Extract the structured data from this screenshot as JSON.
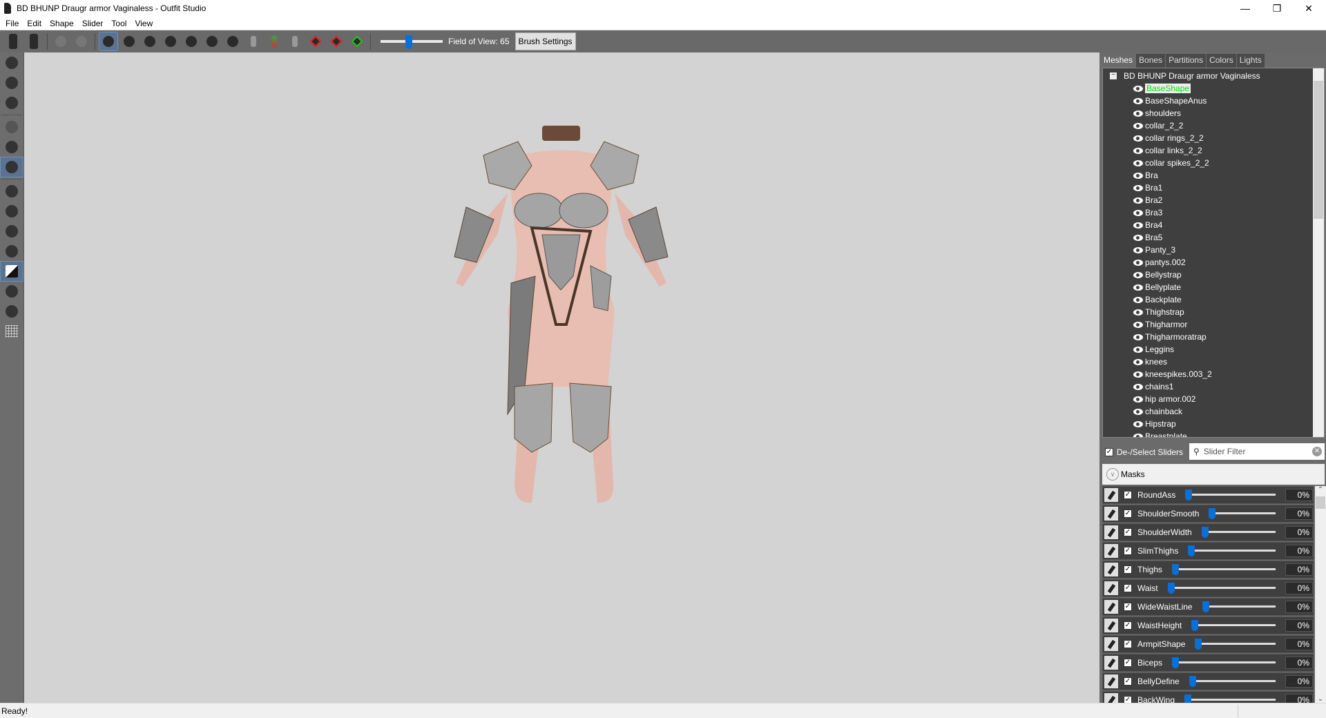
{
  "window": {
    "title": "BD BHUNP Draugr armor Vaginaless - Outfit Studio",
    "controls": [
      "minimize",
      "restore",
      "close"
    ]
  },
  "menu": [
    "File",
    "Edit",
    "Shape",
    "Slider",
    "Tool",
    "View"
  ],
  "toolbar": {
    "tools": [
      "load-reference-icon",
      "load-outfit-icon",
      "undo-icon",
      "redo-icon",
      "select-brush-icon",
      "mask-brush-icon",
      "inflate-brush-icon",
      "deflate-brush-icon",
      "move-brush-icon",
      "smooth-brush-icon",
      "undiff-brush-icon",
      "weight-brush-icon",
      "color-brush-icon",
      "alpha-brush-icon",
      "collapse-vertex-icon",
      "flip-edge-icon",
      "split-edge-icon"
    ],
    "active_tool": "select-brush-icon",
    "fov_label": "Field of View: 65",
    "fov_value": 65,
    "brush_settings_label": "Brush Settings",
    "right_icons": [
      "discord-icon",
      "github-icon",
      "paypal-icon"
    ]
  },
  "left_tools": [
    "transform-icon",
    "pivot-icon",
    "vertex-select-icon",
    "mirror-icon",
    "connected-only-icon",
    "global-brush-icon",
    "brush-center-icon",
    "brush-full-icon",
    "brush-left-icon",
    "brush-right-icon",
    "shaded-mode-icon",
    "wireframe-icon",
    "bones-icon",
    "grid-icon"
  ],
  "right_panel": {
    "tabs": [
      "Meshes",
      "Bones",
      "Partitions",
      "Colors",
      "Lights"
    ],
    "active_tab": "Meshes",
    "tree_root": "BD BHUNP Draugr armor Vaginaless",
    "meshes": [
      "BaseShape",
      "BaseShapeAnus",
      "shoulders",
      "collar_2_2",
      "collar rings_2_2",
      "collar links_2_2",
      "collar spikes_2_2",
      "Bra",
      "Bra1",
      "Bra2",
      "Bra3",
      "Bra4",
      "Bra5",
      "Panty_3",
      "pantys.002",
      "Bellystrap",
      "Bellyplate",
      "Backplate",
      "Thighstrap",
      "Thigharmor",
      "Thigharmoratrap",
      "Leggins",
      "knees",
      "kneespikes.003_2",
      "chains1",
      "hip armor.002",
      "chainback",
      "Hipstrap",
      "Breastplate"
    ],
    "selected_mesh": "BaseShape",
    "deselect_sliders_label": "De-/Select Sliders",
    "slider_filter_placeholder": "Slider Filter",
    "masks_label": "Masks",
    "sliders": [
      {
        "name": "RoundAss",
        "value": "0%"
      },
      {
        "name": "ShoulderSmooth",
        "value": "0%"
      },
      {
        "name": "ShoulderWidth",
        "value": "0%"
      },
      {
        "name": "SlimThighs",
        "value": "0%"
      },
      {
        "name": "Thighs",
        "value": "0%"
      },
      {
        "name": "Waist",
        "value": "0%"
      },
      {
        "name": "WideWaistLine",
        "value": "0%"
      },
      {
        "name": "WaistHeight",
        "value": "0%"
      },
      {
        "name": "ArmpitShape",
        "value": "0%"
      },
      {
        "name": "Biceps",
        "value": "0%"
      },
      {
        "name": "BellyDefine",
        "value": "0%"
      },
      {
        "name": "BackWing",
        "value": "0%"
      }
    ]
  },
  "status": {
    "text": "Ready!"
  },
  "colors": {
    "accent": "#0a6fd6",
    "selected_mesh": "#00e000",
    "viewport_bg": "#d3d3d3",
    "panel_bg": "#3f3f3f"
  }
}
